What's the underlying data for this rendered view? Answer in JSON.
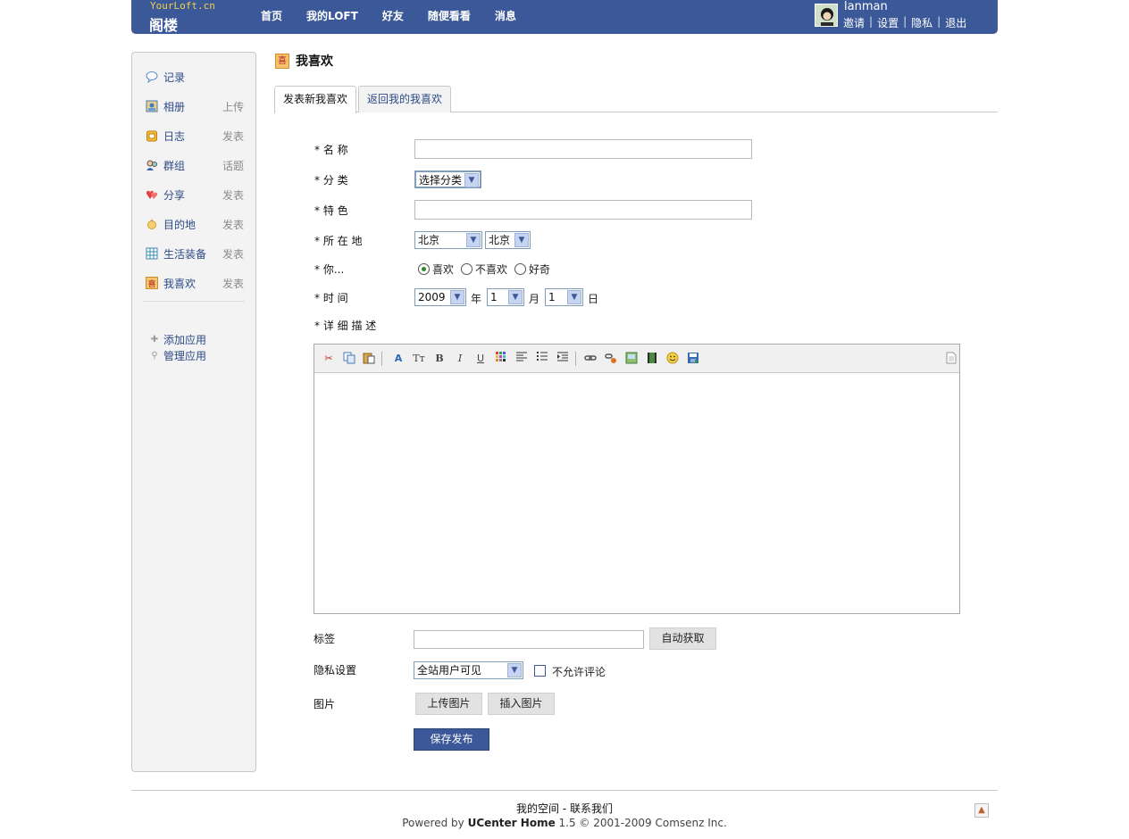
{
  "header": {
    "logo_url": "YourLoft.cn",
    "logo_name": "阁楼",
    "nav": [
      "首页",
      "我的LOFT",
      "好友",
      "随便看看",
      "消息"
    ],
    "username": "lanman",
    "user_menu": [
      "邀请",
      "设置",
      "隐私",
      "退出"
    ]
  },
  "sidebar": {
    "items": [
      {
        "label": "记录",
        "action": "",
        "icon": "chat-bubble-icon"
      },
      {
        "label": "相册",
        "action": "上传",
        "icon": "photo-icon"
      },
      {
        "label": "日志",
        "action": "发表",
        "icon": "blog-icon"
      },
      {
        "label": "群组",
        "action": "话题",
        "icon": "group-icon"
      },
      {
        "label": "分享",
        "action": "发表",
        "icon": "hearts-icon"
      },
      {
        "label": "目的地",
        "action": "发表",
        "icon": "destination-icon"
      },
      {
        "label": "生活装备",
        "action": "发表",
        "icon": "gear-grid-icon"
      },
      {
        "label": "我喜欢",
        "action": "发表",
        "icon": "like-icon"
      }
    ],
    "apps": [
      {
        "label": "添加应用",
        "icon": "plus-icon"
      },
      {
        "label": "管理应用",
        "icon": "wrench-icon"
      }
    ]
  },
  "main": {
    "title": "我喜欢",
    "title_icon_char": "喜",
    "tabs": [
      "发表新我喜欢",
      "返回我的我喜欢"
    ],
    "form": {
      "name_label": "* 名 称",
      "category_label": "* 分 类",
      "category_value": "选择分类",
      "feature_label": "* 特 色",
      "location_label": "* 所 在 地",
      "province_value": "北京",
      "city_value": "北京",
      "you_label": "* 你...",
      "radio_options": [
        "喜欢",
        "不喜欢",
        "好奇"
      ],
      "time_label": "* 时 间",
      "year_value": "2009",
      "year_unit": "年",
      "month_value": "1",
      "month_unit": "月",
      "day_value": "1",
      "day_unit": "日",
      "desc_label": "* 详 细 描 述",
      "tag_label": "标签",
      "auto_fetch": "自动获取",
      "privacy_label": "隐私设置",
      "privacy_value": "全站用户可见",
      "no_comment": "不允许评论",
      "image_label": "图片",
      "upload_image": "上传图片",
      "insert_image": "插入图片",
      "submit": "保存发布"
    }
  },
  "footer": {
    "links": "我的空间 - 联系我们",
    "powered_prefix": "Powered by ",
    "powered_brand": "UCenter Home",
    "powered_suffix": " 1.5 © 2001-2009 Comsenz Inc."
  },
  "colors": {
    "brand": "#3b5998",
    "link": "#2c4a86",
    "logo_accent": "#f0d04a"
  }
}
